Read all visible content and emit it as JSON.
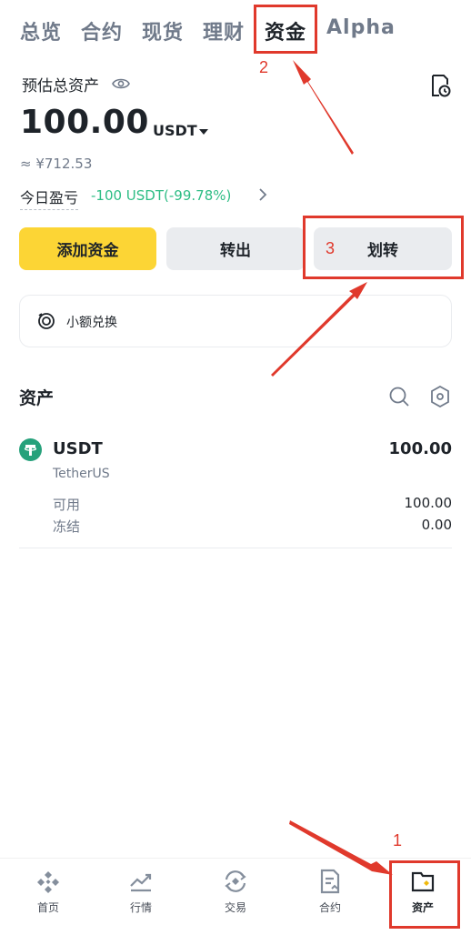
{
  "tabs": [
    {
      "label": "总览",
      "active": false
    },
    {
      "label": "合约",
      "active": false
    },
    {
      "label": "现货",
      "active": false
    },
    {
      "label": "理财",
      "active": false
    },
    {
      "label": "资金",
      "active": true
    },
    {
      "label": "Alpha",
      "active": false
    }
  ],
  "header": {
    "estimated_label": "预估总资产",
    "balance": "100.00",
    "currency": "USDT",
    "approx_fiat": "≈ ¥712.53",
    "pnl_label": "今日盈亏",
    "pnl_value": "-100 USDT(-99.78%)"
  },
  "actions": {
    "add_funds": "添加资金",
    "withdraw": "转出",
    "transfer": "划转"
  },
  "convert": {
    "label": "小额兑换"
  },
  "assets": {
    "title": "资产",
    "items": [
      {
        "symbol": "USDT",
        "name": "TetherUS",
        "total": "100.00",
        "available_label": "可用",
        "available": "100.00",
        "frozen_label": "冻结",
        "frozen": "0.00"
      }
    ]
  },
  "bottom_nav": [
    {
      "label": "首页",
      "icon": "home-icon"
    },
    {
      "label": "行情",
      "icon": "markets-icon"
    },
    {
      "label": "交易",
      "icon": "trade-icon"
    },
    {
      "label": "合约",
      "icon": "futures-icon"
    },
    {
      "label": "资产",
      "icon": "wallet-icon",
      "active": true
    }
  ],
  "annotations": [
    "1",
    "2",
    "3"
  ],
  "colors": {
    "accent": "#fcd535",
    "positive": "#2ebd85",
    "annotation": "#e0392c",
    "text_primary": "#1e2329",
    "text_secondary": "#707a8a"
  }
}
